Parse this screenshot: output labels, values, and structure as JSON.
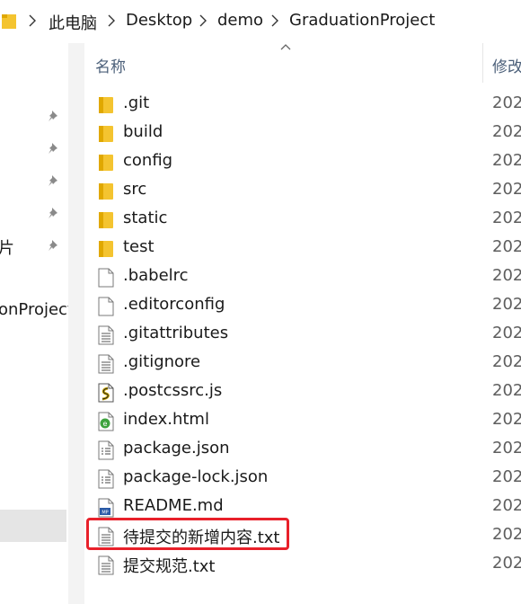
{
  "address_bar": {
    "crumbs": [
      "此电脑",
      "Desktop",
      "demo",
      "GraduationProject"
    ]
  },
  "sidebar": {
    "text_1": "片",
    "text_2": "onProject"
  },
  "columns": {
    "name": "名称",
    "modified": "修改"
  },
  "files": [
    {
      "name": ".git",
      "icon": "folder-icon",
      "date": "202"
    },
    {
      "name": "build",
      "icon": "folder-icon",
      "date": "202"
    },
    {
      "name": "config",
      "icon": "folder-icon",
      "date": "202"
    },
    {
      "name": "src",
      "icon": "folder-icon",
      "date": "202"
    },
    {
      "name": "static",
      "icon": "folder-icon",
      "date": "202"
    },
    {
      "name": "test",
      "icon": "folder-icon",
      "date": "202"
    },
    {
      "name": ".babelrc",
      "icon": "blank-file-icon",
      "date": "202"
    },
    {
      "name": ".editorconfig",
      "icon": "blank-file-icon",
      "date": "202"
    },
    {
      "name": ".gitattributes",
      "icon": "text-file-icon",
      "date": "202"
    },
    {
      "name": ".gitignore",
      "icon": "text-file-icon",
      "date": "202"
    },
    {
      "name": ".postcssrc.js",
      "icon": "js-file-icon",
      "date": "202"
    },
    {
      "name": "index.html",
      "icon": "html-file-icon",
      "date": "202"
    },
    {
      "name": "package.json",
      "icon": "json-file-icon",
      "date": "202"
    },
    {
      "name": "package-lock.json",
      "icon": "json-file-icon",
      "date": "202"
    },
    {
      "name": "README.md",
      "icon": "md-file-icon",
      "date": "202"
    },
    {
      "name": "待提交的新增内容.txt",
      "icon": "text-file-icon",
      "date": "202"
    },
    {
      "name": "提交规范.txt",
      "icon": "text-file-icon",
      "date": "202"
    }
  ],
  "colors": {
    "highlight": "#e8202a",
    "folder": "#f4c430",
    "header_text": "#4c607a"
  }
}
